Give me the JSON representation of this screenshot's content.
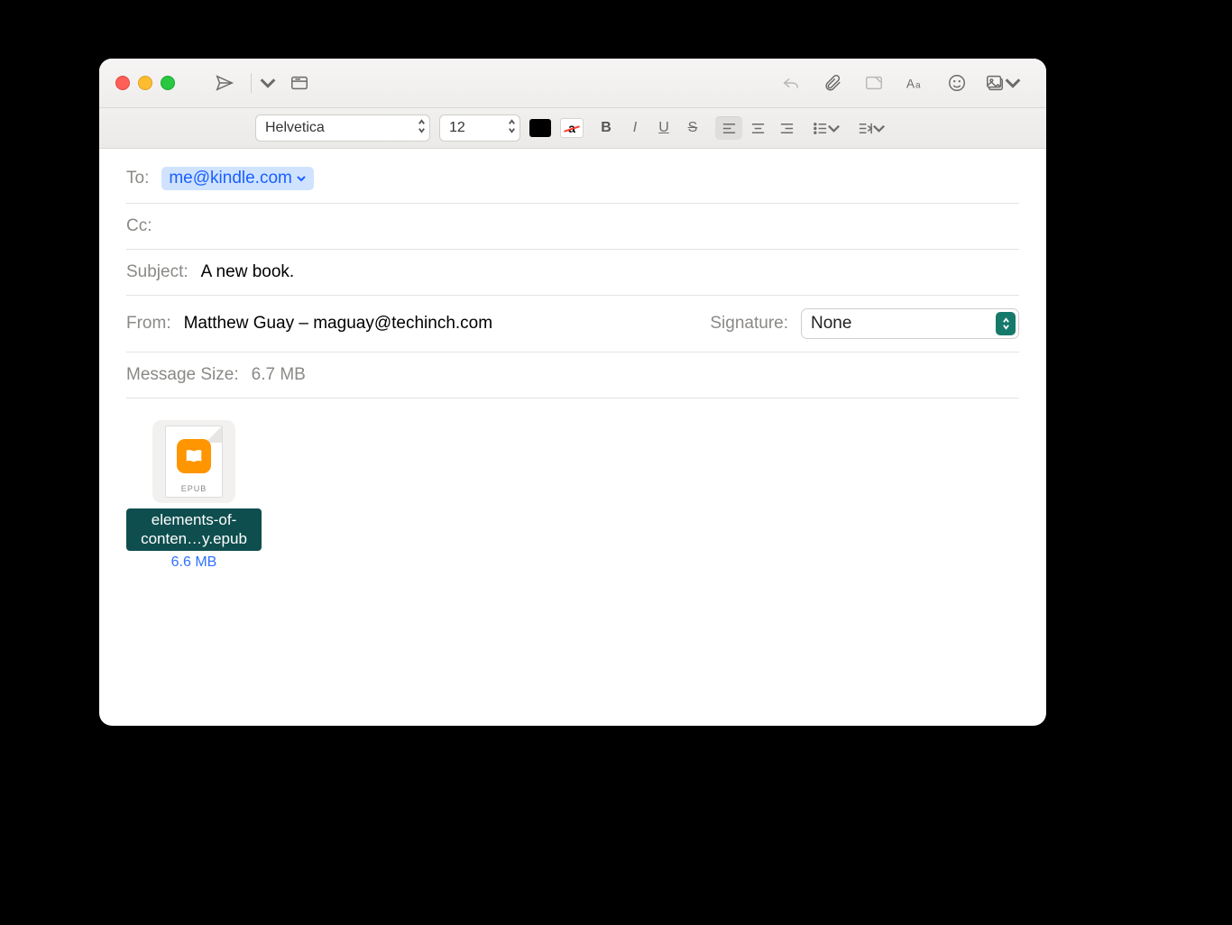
{
  "toolbar": {
    "font_family": "Helvetica",
    "font_size": "12"
  },
  "fields": {
    "to_label": "To:",
    "to_recipient": "me@kindle.com",
    "cc_label": "Cc:",
    "subject_label": "Subject:",
    "subject_value": "A new book.",
    "from_label": "From:",
    "from_value": "Matthew Guay – maguay@techinch.com",
    "signature_label": "Signature:",
    "signature_value": "None",
    "size_label": "Message Size:",
    "size_value": "6.7 MB"
  },
  "attachment": {
    "badge": "EPUB",
    "filename": "elements-of-conten…y.epub",
    "filesize": "6.6 MB"
  }
}
